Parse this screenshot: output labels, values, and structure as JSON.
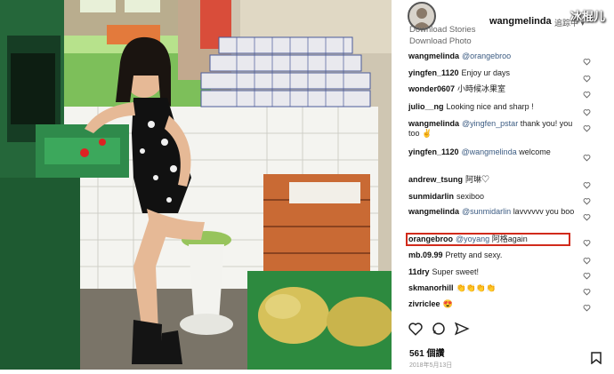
{
  "watermark": "冰棍儿",
  "header": {
    "username": "wangmelinda",
    "follow_label": "追踪中 ▾"
  },
  "menu": [
    "Download Stories",
    "Download Photo"
  ],
  "comments": [
    {
      "user": "wangmelinda",
      "mention": "@orangebroo",
      "text": ""
    },
    {
      "user": "yingfen_1120",
      "mention": "",
      "text": "Enjoy ur days"
    },
    {
      "user": "wonder0607",
      "mention": "",
      "text": "小時候冰果室"
    },
    {
      "user": "julio__ng",
      "mention": "",
      "text": "Looking nice and sharp !"
    },
    {
      "user": "wangmelinda",
      "mention": "@yingfen_pstar",
      "text": "thank you! you too ✌️"
    },
    {
      "user": "yingfen_1120",
      "mention": "@wangmelinda",
      "text": "welcome"
    },
    {
      "user": "andrew_tsung",
      "mention": "",
      "text": "阿琳♡"
    },
    {
      "user": "sunmidarlin",
      "mention": "",
      "text": "sexiboo"
    },
    {
      "user": "wangmelinda",
      "mention": "@sunmidarlin",
      "text": "lavvvvvv you boo"
    },
    {
      "user": "orangebroo",
      "mention": "@yoyang",
      "text": "阿格again"
    },
    {
      "user": "mb.09.99",
      "mention": "",
      "text": "Pretty and sexy."
    },
    {
      "user": "11dry",
      "mention": "",
      "text": "Super sweet!"
    },
    {
      "user": "skmanorhill",
      "mention": "",
      "text": "👏👏👏👏"
    },
    {
      "user": "zivriclee",
      "mention": "",
      "text": "😍"
    }
  ],
  "likes": "561 個讚",
  "date": "2018年5月13日",
  "colors": {
    "highlight_box": "#d12a1b",
    "mention": "#3b5b82"
  },
  "icons": [
    "heart-icon",
    "comment-icon",
    "share-icon",
    "bookmark-icon"
  ]
}
